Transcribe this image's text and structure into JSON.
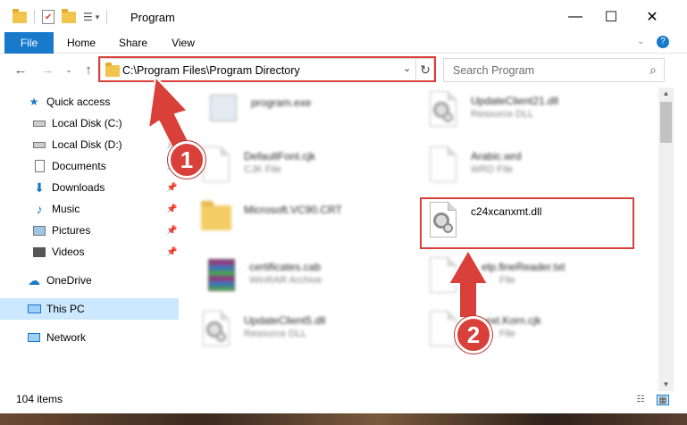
{
  "window": {
    "title": "Program",
    "controls": {
      "minimize": "—",
      "maximize": "☐",
      "close": "✕"
    }
  },
  "ribbon": {
    "tabs": [
      "File",
      "Home",
      "Share",
      "View"
    ]
  },
  "address": {
    "path": "C:\\Program Files\\Program Directory"
  },
  "search": {
    "placeholder": "Search Program"
  },
  "navpane": {
    "items": [
      {
        "label": "Quick access",
        "icon": "star-icon"
      },
      {
        "label": "Local Disk (C:)",
        "icon": "drive-icon"
      },
      {
        "label": "Local Disk (D:)",
        "icon": "drive-icon"
      },
      {
        "label": "Documents",
        "icon": "documents-icon"
      },
      {
        "label": "Downloads",
        "icon": "downloads-icon"
      },
      {
        "label": "Music",
        "icon": "music-icon"
      },
      {
        "label": "Pictures",
        "icon": "pictures-icon"
      },
      {
        "label": "Videos",
        "icon": "videos-icon"
      },
      {
        "label": "OneDrive",
        "icon": "cloud-icon"
      },
      {
        "label": "This PC",
        "icon": "computer-icon"
      },
      {
        "label": "Network",
        "icon": "network-icon"
      }
    ]
  },
  "files": [
    {
      "name": "program.exe",
      "type": ""
    },
    {
      "name": "UpdateClient21.dll",
      "type": "Resource DLL"
    },
    {
      "name": "DefaultFont.cjk",
      "type": "CJK File"
    },
    {
      "name": "Arabic.wrd",
      "type": "WRD File"
    },
    {
      "name": "Microsoft.VC90.CRT",
      "type": ""
    },
    {
      "name": "c24xcanxmt.dll",
      "type": ""
    },
    {
      "name": "certificates.cab",
      "type": "WinRAR Archive"
    },
    {
      "name": "elp.fineReader.txt",
      "type": "File"
    },
    {
      "name": "UpdateClient5.dll",
      "type": "Resource DLL"
    },
    {
      "name": "ext.Korn.cjk",
      "type": "File"
    }
  ],
  "status": {
    "items_count": "104 items"
  },
  "annotations": {
    "step1": "1",
    "step2": "2",
    "color": "#d9403a"
  }
}
